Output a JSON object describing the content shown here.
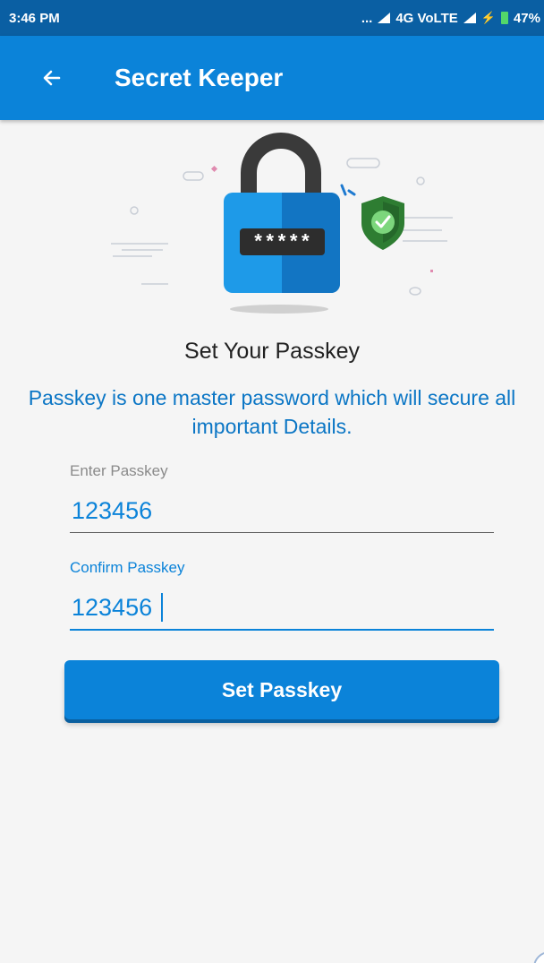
{
  "status_bar": {
    "time": "3:46 PM",
    "dots": "...",
    "network": "4G VoLTE",
    "battery": "47%"
  },
  "app_bar": {
    "title": "Secret Keeper",
    "back_icon": "arrow-left-icon"
  },
  "illustration": {
    "masked_text": "*****",
    "icons": [
      "padlock-icon",
      "shield-check-icon"
    ]
  },
  "content": {
    "heading": "Set Your Passkey",
    "description": "Passkey is one master password which will secure all important Details."
  },
  "form": {
    "enter_label": "Enter Passkey",
    "enter_value": "123456",
    "confirm_label": "Confirm Passkey",
    "confirm_value": "123456",
    "submit_label": "Set Passkey"
  },
  "colors": {
    "accent": "#0b83d9",
    "status_bar": "#0a5fa3",
    "background": "#f5f5f5",
    "shield": "#2e7d32",
    "check": "#7cd67c"
  }
}
